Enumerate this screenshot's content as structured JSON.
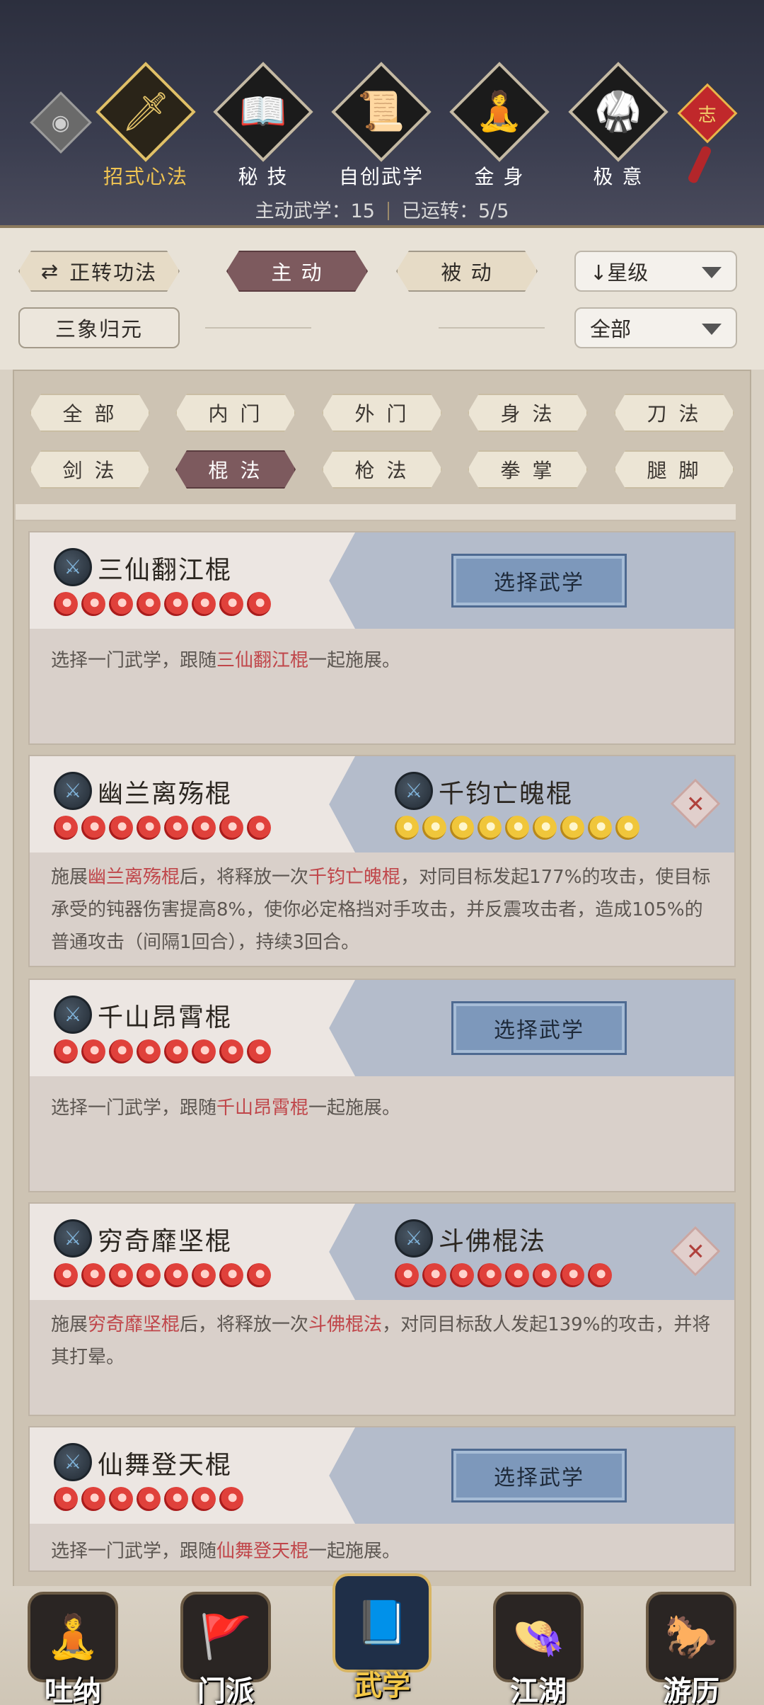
{
  "header": {
    "tabs": [
      {
        "label": "招式心法",
        "icon": "sword-icon",
        "glyph": "🗡",
        "active": true
      },
      {
        "label": "秘 技",
        "icon": "book-icon",
        "glyph": "📖",
        "active": false
      },
      {
        "label": "自创武学",
        "icon": "scroll-icon",
        "glyph": "📜",
        "active": false
      },
      {
        "label": "金 身",
        "icon": "meditation-icon",
        "glyph": "🧘",
        "active": false
      },
      {
        "label": "极 意",
        "icon": "martial-stance-icon",
        "glyph": "🥋",
        "active": false
      }
    ],
    "knot_char": "志",
    "eye_glyph": "◉",
    "stats": {
      "active_label": "主动武学：15",
      "running_label": "已运转：5/5"
    }
  },
  "controls": {
    "switch_label": "正转功法",
    "switch_icon": "⇄",
    "active_label": "主 动",
    "passive_label": "被 动",
    "sort_label": "↓星级",
    "sanxiang_label": "三象归元",
    "filter_all_label": "全部"
  },
  "filters": [
    "全 部",
    "内 门",
    "外 门",
    "身 法",
    "刀 法",
    "剑 法",
    "棍 法",
    "枪 法",
    "拳 掌",
    "腿 脚"
  ],
  "active_filter_index": 6,
  "skills": [
    {
      "name": "三仙翻江棍",
      "stars": 8,
      "paired": false,
      "button_label": "选择武学",
      "desc_pre": "选择一门武学，跟随",
      "desc_hl": "三仙翻江棍",
      "desc_post": "一起施展。"
    },
    {
      "name": "幽兰离殇棍",
      "stars": 8,
      "paired": true,
      "pair_name": "千钧亡魄棍",
      "pair_stars": 9,
      "pair_star_color": "gold",
      "desc_pre": "施展",
      "desc_hl": "幽兰离殇棍",
      "desc_mid": "后，将释放一次",
      "desc_hl2": "千钧亡魄棍",
      "desc_post": "，对同目标发起177%的攻击，使目标承受的钝器伤害提高8%，使你必定格挡对手攻击，并反震攻击者，造成105%的普通攻击（间隔1回合），持续3回合。"
    },
    {
      "name": "千山昂霄棍",
      "stars": 8,
      "paired": false,
      "button_label": "选择武学",
      "desc_pre": "选择一门武学，跟随",
      "desc_hl": "千山昂霄棍",
      "desc_post": "一起施展。"
    },
    {
      "name": "穷奇靡坚棍",
      "stars": 8,
      "paired": true,
      "pair_name": "斗佛棍法",
      "pair_stars": 8,
      "pair_star_color": "red",
      "desc_pre": "施展",
      "desc_hl": "穷奇靡坚棍",
      "desc_mid": "后，将释放一次",
      "desc_hl2": "斗佛棍法",
      "desc_post": "，对同目标敌人发起139%的攻击，并将其打晕。"
    },
    {
      "name": "仙舞登天棍",
      "stars": 7,
      "paired": false,
      "button_label": "选择武学",
      "desc_pre": "选择一门武学，跟随",
      "desc_hl": "仙舞登天棍",
      "desc_post": "一起施展。"
    }
  ],
  "bottom_nav": [
    {
      "label": "吐纳",
      "icon": "monk-icon",
      "glyph": "🧘",
      "active": false
    },
    {
      "label": "门派",
      "icon": "sect-banner-icon",
      "glyph": "🚩",
      "active": false
    },
    {
      "label": "武学",
      "icon": "manual-icon",
      "glyph": "📘",
      "active": true
    },
    {
      "label": "江湖",
      "icon": "straw-hat-icon",
      "glyph": "👒",
      "active": false
    },
    {
      "label": "游历",
      "icon": "horse-icon",
      "glyph": "🐎",
      "active": false
    }
  ]
}
